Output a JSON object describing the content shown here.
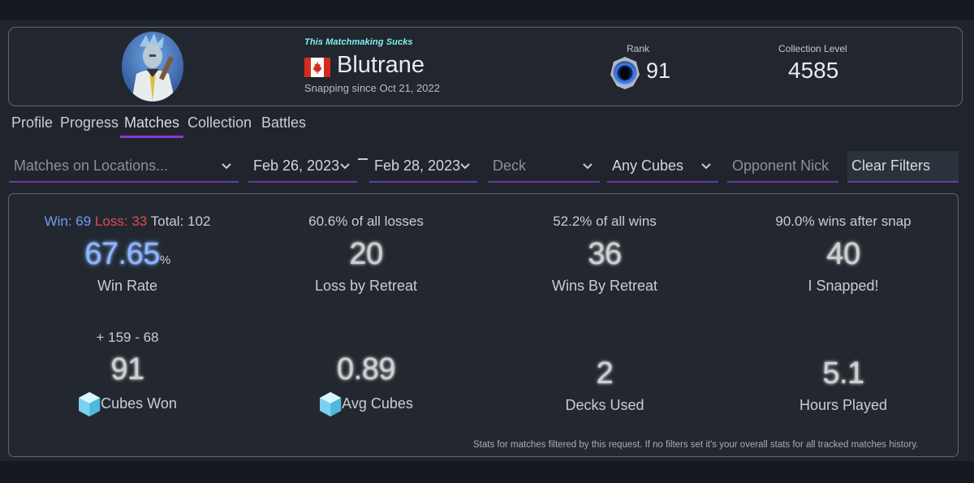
{
  "profile": {
    "tagline": "This Matchmaking Sucks",
    "player_name": "Blutrane",
    "since": "Snapping since Oct 21, 2022",
    "rank_label": "Rank",
    "rank_value": "91",
    "collection_label": "Collection Level",
    "collection_value": "4585"
  },
  "tabs": [
    {
      "label": "Profile",
      "active": false
    },
    {
      "label": "Progress",
      "active": false
    },
    {
      "label": "Matches",
      "active": true
    },
    {
      "label": "Collection",
      "active": false
    },
    {
      "label": "Battles",
      "active": false
    }
  ],
  "filters": {
    "locations_placeholder": "Matches on Locations...",
    "date_from": "Feb 26, 2023",
    "date_to": "Feb 28, 2023",
    "deck_placeholder": "Deck",
    "cubes_value": "Any Cubes",
    "opponent_placeholder": "Opponent Nick",
    "clear_label": "Clear Filters"
  },
  "stats": {
    "win_label": "Win:",
    "win_value": "69",
    "loss_label": "Loss:",
    "loss_value": "33",
    "total_label": "Total:",
    "total_value": "102",
    "win_rate_value": "67.65",
    "win_rate_unit": "%",
    "win_rate_label": "Win Rate",
    "loss_retreat_top": "60.6% of all losses",
    "loss_retreat_value": "20",
    "loss_retreat_label": "Loss by Retreat",
    "win_retreat_top": "52.2% of all wins",
    "win_retreat_value": "36",
    "win_retreat_label": "Wins By Retreat",
    "snapped_top": "90.0% wins after snap",
    "snapped_value": "40",
    "snapped_label": "I Snapped!",
    "cubes_top": "+ 159 - 68",
    "cubes_value": "91",
    "cubes_label": "Cubes Won",
    "avg_cubes_value": "0.89",
    "avg_cubes_label": "Avg Cubes",
    "decks_value": "2",
    "decks_label": "Decks Used",
    "hours_value": "5.1",
    "hours_label": "Hours Played",
    "footnote": "Stats for matches filtered by this request. If no filters set it's your overall stats for all tracked matches history."
  },
  "colors": {
    "accent_purple": "#8d3bd0",
    "tagline_cyan": "#7ff0ef",
    "win_blue": "#6f9df0",
    "loss_red": "#e34b4b"
  },
  "icons": [
    "canada-flag-icon",
    "rank-icon",
    "cube-icon",
    "chevron-down-icon"
  ]
}
